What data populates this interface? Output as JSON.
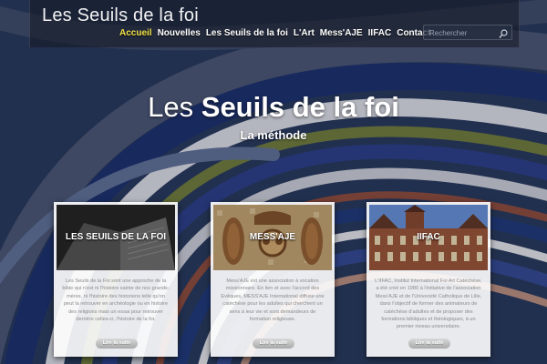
{
  "site": {
    "title": "Les Seuils de la foi"
  },
  "nav": {
    "items": [
      {
        "label": "Accueil",
        "active": true
      },
      {
        "label": "Nouvelles",
        "active": false
      },
      {
        "label": "Les Seuils de la foi",
        "active": false
      },
      {
        "label": "L'Art",
        "active": false
      },
      {
        "label": "Mess'AJE",
        "active": false
      },
      {
        "label": "IIFAC",
        "active": false
      },
      {
        "label": "Contact",
        "active": false
      }
    ]
  },
  "search": {
    "placeholder": "Rechercher"
  },
  "hero": {
    "title_light": "Les",
    "title_bold": "Seuils de la foi",
    "subtitle": "La méthode"
  },
  "cards": [
    {
      "label": "LES SEUILS DE LA FOI",
      "image": "open-book-photo",
      "text": "Les Seuils de la Foi sont une approche de la bible qui n'est ni l'histoire sainte de nos grands-mères, ni l'histoire des historiens telle qu'on peut la retrouver en archéologie ou en histoire des religions mais un essai pour retrouver derrière celles-ci, l'histoire de la foi.",
      "button": "Lire la suite"
    },
    {
      "label": "MESS'AJE",
      "image": "fish-mosaic-photo",
      "text": "Mess'AJE est une association à vocation missionnaire. En lien et avec l'accord des Evêques, MESS'AJE International diffuse une catéchèse pour les adultes qui cherchent un sens à leur vie et sont demandeurs de formation religieuse.",
      "button": "Lire la suite"
    },
    {
      "label": "IIFAC",
      "image": "university-building-photo",
      "text": "L'IIFAC, Institut International Foi Art Catéchèse, a été créé en 1980 à l'initiative de l'association Mess'AJE et de l'Université Catholique de Lille, dans l'objectif de former des animateurs de catéchèse d'adultes et de proposer des formations bibliques et théologiques, à un premier niveau universitaire.",
      "button": "Lire la suite"
    }
  ],
  "colors": {
    "nav_active": "#f3e34a",
    "header_bg": "#141822"
  }
}
